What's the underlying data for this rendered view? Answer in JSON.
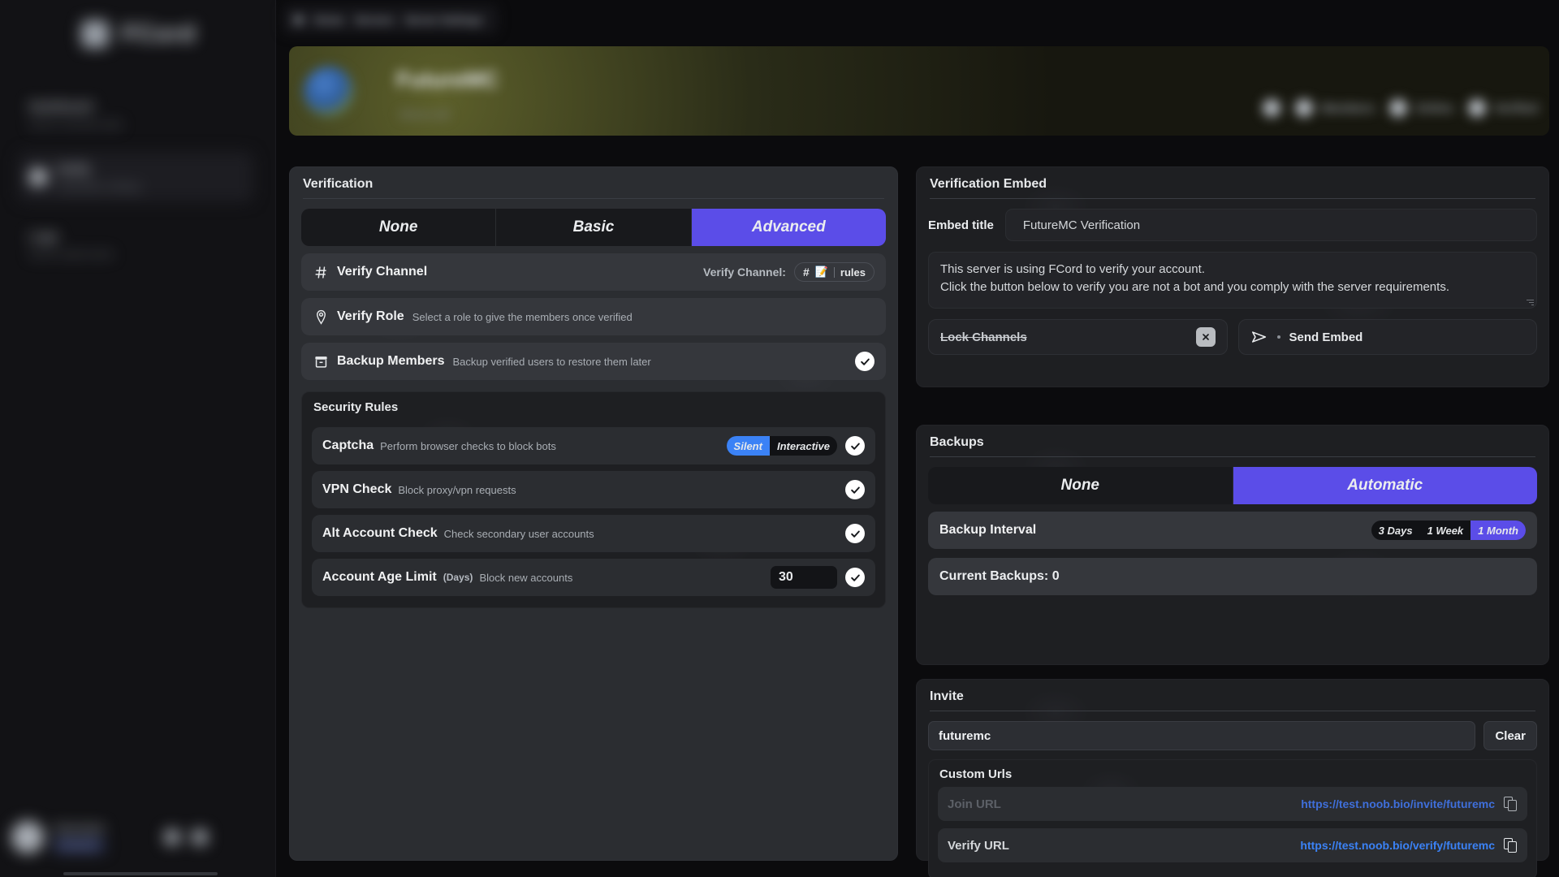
{
  "sidebar": {
    "brand": {
      "name": "FCord",
      "logo_icon": "fcord-logo-icon"
    },
    "items": [
      {
        "label": "Dashboard",
        "sub": "Server overview stats",
        "icon": "dashboard-icon",
        "active": false
      },
      {
        "label": "Verify",
        "sub": "Verification settings",
        "icon": "verify-icon",
        "active": true
      },
      {
        "label": "Logs",
        "sub": "Server audit events",
        "icon": "logs-icon",
        "active": false
      }
    ],
    "user": {
      "name": "Username",
      "tag": "Premium",
      "icons": [
        "settings-icon",
        "logout-icon"
      ]
    }
  },
  "topbar": {
    "crumbs": [
      "Home",
      "Servers",
      "Server Settings"
    ]
  },
  "banner": {
    "server_name": "FutureMC",
    "server_sub": "Minecraft",
    "stats": [
      {
        "icon": "members-icon",
        "label": ""
      },
      {
        "icon": "online-icon",
        "label": "Members"
      },
      {
        "icon": "boosts-icon",
        "label": "Online"
      },
      {
        "icon": "roles-icon",
        "label": "Verified"
      }
    ]
  },
  "verification": {
    "section_title": "Verification",
    "tabs": [
      {
        "label": "None",
        "selected": false
      },
      {
        "label": "Basic",
        "selected": false
      },
      {
        "label": "Advanced",
        "selected": true
      }
    ],
    "verify_channel": {
      "label": "Verify Channel",
      "icon": "hash-icon",
      "right_label": "Verify Channel:",
      "channel_hash": "#",
      "channel_emoji": "📝",
      "channel_name": "rules"
    },
    "verify_role": {
      "label": "Verify Role",
      "desc": "Select a role to give the members once verified",
      "icon": "shield-pin-icon"
    },
    "backup_members": {
      "label": "Backup Members",
      "desc": "Backup verified users to restore them later",
      "icon": "archive-icon",
      "enabled": true
    }
  },
  "security_rules": {
    "section_title": "Security Rules",
    "rules": [
      {
        "label": "Captcha",
        "desc": "Perform browser checks to block bots",
        "unit": "",
        "enabled": true,
        "mode_pills": [
          {
            "label": "Silent",
            "selected": true,
            "color": "blue"
          },
          {
            "label": "Interactive",
            "selected": false,
            "color": "none"
          }
        ],
        "value": null
      },
      {
        "label": "VPN Check",
        "desc": "Block proxy/vpn requests",
        "unit": "",
        "enabled": true,
        "mode_pills": [],
        "value": null
      },
      {
        "label": "Alt Account Check",
        "desc": "Check secondary user accounts",
        "unit": "",
        "enabled": true,
        "mode_pills": [],
        "value": null
      },
      {
        "label": "Account Age Limit",
        "desc": "Block new accounts",
        "unit": "(Days)",
        "enabled": true,
        "mode_pills": [],
        "value": "30"
      }
    ]
  },
  "embed": {
    "section_title": "Verification Embed",
    "title_label": "Embed title",
    "title_value": "FutureMC Verification",
    "title_icon": "pin-icon",
    "body_line1": "This server is using FCord to verify your account.",
    "body_line2": "Click the button below to verify you are not a bot and you comply with the server requirements.",
    "lock_channels": {
      "label": "Lock Channels",
      "strikethrough": true,
      "close_icon": "x-icon"
    },
    "send_embed": {
      "label": "Send Embed",
      "icon": "send-icon"
    }
  },
  "backups": {
    "section_title": "Backups",
    "tabs": [
      {
        "label": "None",
        "selected": false
      },
      {
        "label": "Automatic",
        "selected": true
      }
    ],
    "interval_label": "Backup Interval",
    "interval_options": [
      {
        "label": "3 Days",
        "selected": false
      },
      {
        "label": "1 Week",
        "selected": false
      },
      {
        "label": "1 Month",
        "selected": true
      }
    ],
    "current_backups": "Current Backups: 0"
  },
  "invite": {
    "section_title": "Invite",
    "code_value": "futuremc",
    "clear_label": "Clear",
    "custom_urls_title": "Custom Urls",
    "urls": [
      {
        "label": "Join URL",
        "prefix": "https://test.noob.bio/invite/",
        "code": "futuremc",
        "active": false,
        "copy_icon": "copy-icon"
      },
      {
        "label": "Verify URL",
        "prefix": "https://test.noob.bio/verify/",
        "code": "futuremc",
        "active": true,
        "copy_icon": "copy-icon"
      }
    ]
  },
  "colors": {
    "accent_purple": "#5b4de8",
    "accent_blue": "#3b82f6",
    "link_blue": "#3b82f6",
    "panel": "#2b2d31",
    "panel_dark": "#1e1f22",
    "row": "#35373c",
    "pink": "#ec2a76"
  }
}
